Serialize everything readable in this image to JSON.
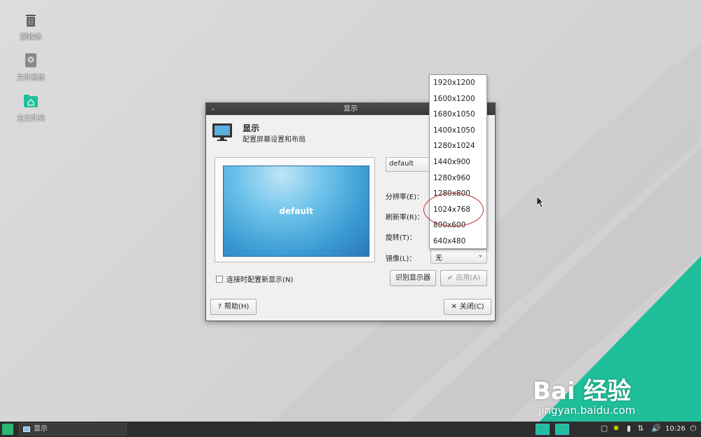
{
  "desktop": {
    "icons": [
      {
        "label": "回收站",
        "icon": "trash-icon"
      },
      {
        "label": "文件系统",
        "icon": "drive-icon"
      },
      {
        "label": "主文件夹",
        "icon": "home-folder-icon"
      }
    ]
  },
  "dialog": {
    "window_title": "显示",
    "header_title": "显示",
    "header_subtitle": "配置屏幕设置和布局",
    "preview_label": "default",
    "monitor_select": "default",
    "resolution_label": "分辨率(E)：",
    "refresh_label": "刷新率(R)：",
    "rotation_label": "旋转(T)：",
    "mirror_label": "镜像(L)：",
    "mirror_value": "无",
    "reconnect_checkbox_label": "连接时配置新显示(N)",
    "identify_button": "识别显示器",
    "apply_button": "应用(A)",
    "help_button": "帮助(H)",
    "close_button": "关闭(C)"
  },
  "resolution_dropdown": {
    "options": [
      "1920x1200",
      "1600x1200",
      "1680x1050",
      "1400x1050",
      "1280x1024",
      "1440x900",
      "1280x960",
      "1280x800",
      "1024x768",
      "800x600",
      "640x480"
    ],
    "highlighted": "1024x768",
    "annotation_color": "#c0302b"
  },
  "watermark": {
    "brand": "Bai 经验",
    "url": "jingyan.baidu.com"
  },
  "taskbar": {
    "task_label": "显示",
    "clock": "10:26",
    "accent_color": "#1fbf9b"
  }
}
